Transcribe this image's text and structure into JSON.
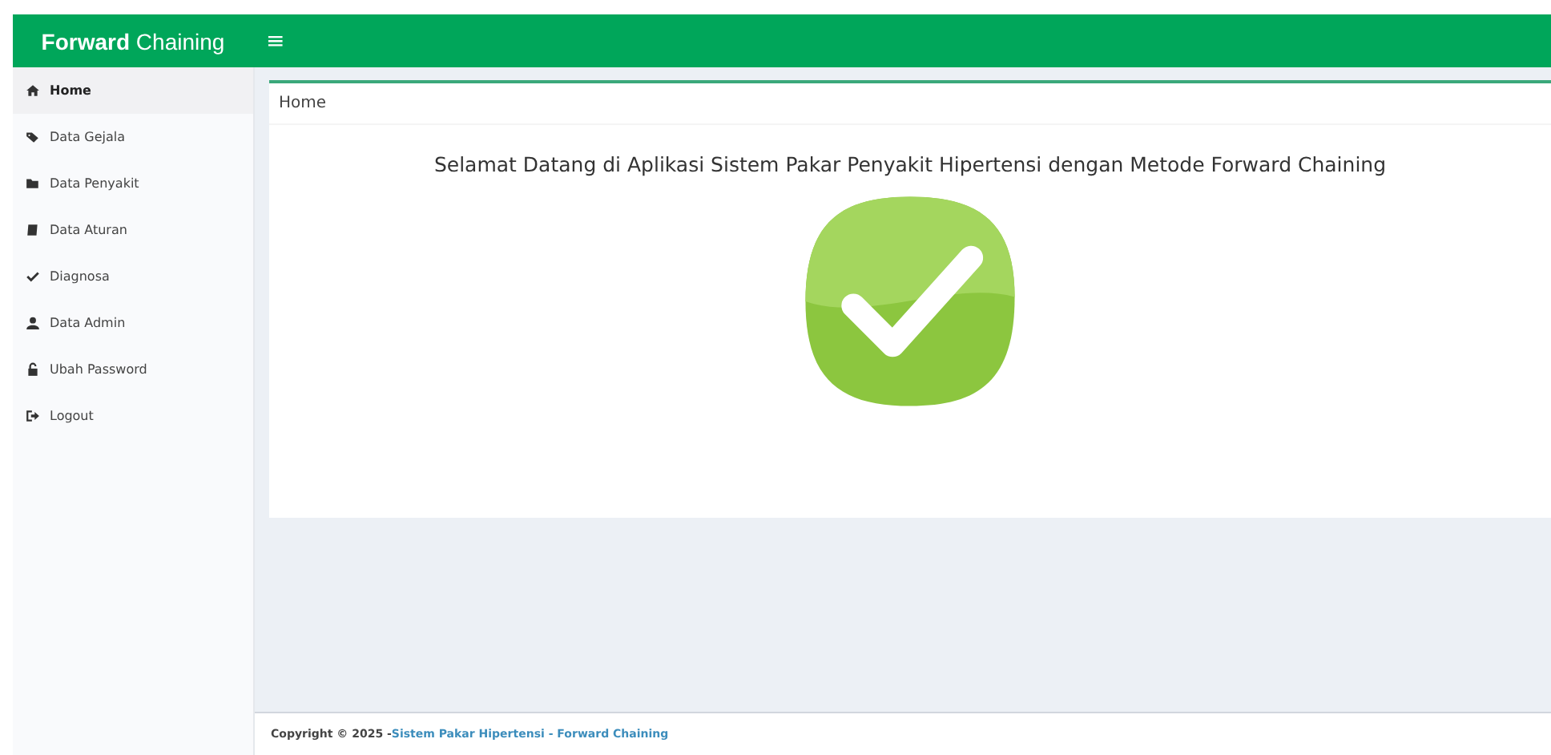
{
  "header": {
    "brand_bold": "Forward",
    "brand_rest": "Chaining",
    "menu_toggle": "≡"
  },
  "sidebar": {
    "items": [
      {
        "label": "Home",
        "selected": true
      },
      {
        "label": "Data Gejala",
        "selected": false
      },
      {
        "label": "Data Penyakit",
        "selected": false
      },
      {
        "label": "Data Aturan",
        "selected": false
      },
      {
        "label": "Diagnosa",
        "selected": false
      },
      {
        "label": "Data Admin",
        "selected": false
      },
      {
        "label": "Ubah Password",
        "selected": false
      },
      {
        "label": "Logout",
        "selected": false
      }
    ]
  },
  "content": {
    "box_title": "Home",
    "welcome": "Selamat Datang di Aplikasi Sistem Pakar Penyakit Hipertensi dengan Metode Forward Chaining"
  },
  "footer": {
    "copyright": "Copyright © 2025 - ",
    "link": "Sistem Pakar Hipertensi - Forward Chaining"
  }
}
